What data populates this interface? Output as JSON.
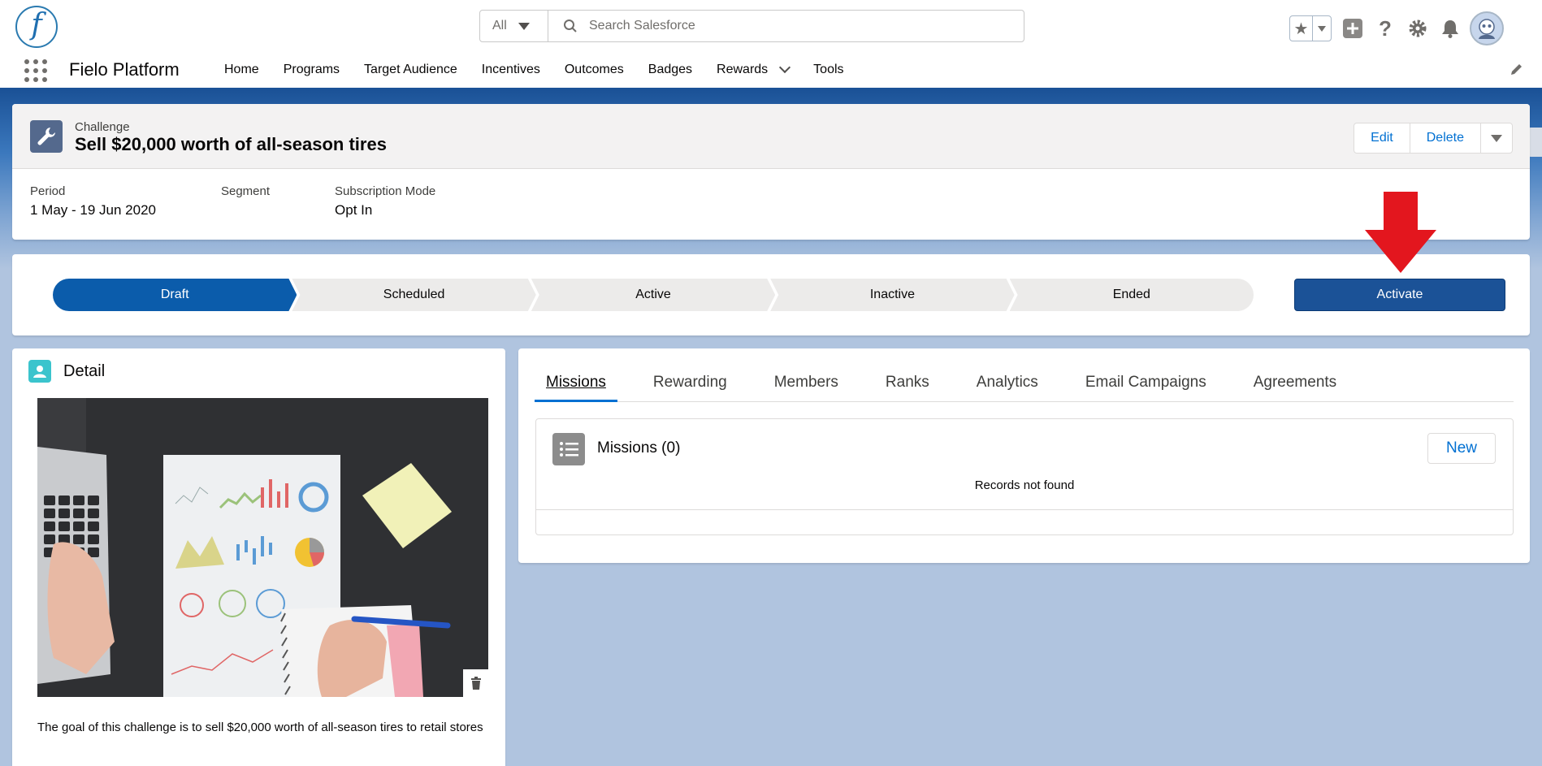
{
  "header": {
    "logo_letter": "f",
    "search_scope": "All",
    "search_placeholder": "Search Salesforce",
    "icons": [
      "star-icon",
      "add-icon",
      "help-icon",
      "setup-gear-icon",
      "notification-bell-icon",
      "avatar"
    ]
  },
  "nav": {
    "app_name": "Fielo Platform",
    "items": [
      {
        "label": "Home"
      },
      {
        "label": "Programs"
      },
      {
        "label": "Target Audience"
      },
      {
        "label": "Incentives"
      },
      {
        "label": "Outcomes"
      },
      {
        "label": "Badges"
      },
      {
        "label": "Rewards"
      },
      {
        "label": "Tools"
      }
    ]
  },
  "record": {
    "type": "Challenge",
    "title": "Sell $20,000 worth of all-season tires",
    "actions": {
      "edit": "Edit",
      "delete": "Delete"
    },
    "fields": [
      {
        "label": "Period",
        "value": "1 May - 19 Jun 2020"
      },
      {
        "label": "Segment",
        "value": ""
      },
      {
        "label": "Subscription Mode",
        "value": "Opt In"
      }
    ]
  },
  "path": {
    "stages": [
      "Draft",
      "Scheduled",
      "Active",
      "Inactive",
      "Ended"
    ],
    "current": "Draft",
    "action_label": "Activate"
  },
  "detail": {
    "title": "Detail",
    "description": "The goal of this challenge is to sell $20,000 worth of all-season tires to retail stores"
  },
  "tabs": {
    "items": [
      "Missions",
      "Rewarding",
      "Members",
      "Ranks",
      "Analytics",
      "Email Campaigns",
      "Agreements"
    ],
    "active": "Missions"
  },
  "missions": {
    "title": "Missions (0)",
    "new_label": "New",
    "empty_message": "Records not found"
  },
  "colors": {
    "brand": "#1b5297",
    "link": "#0070d2",
    "path_current": "#0b5cab",
    "annotation_arrow": "#e3161e"
  }
}
